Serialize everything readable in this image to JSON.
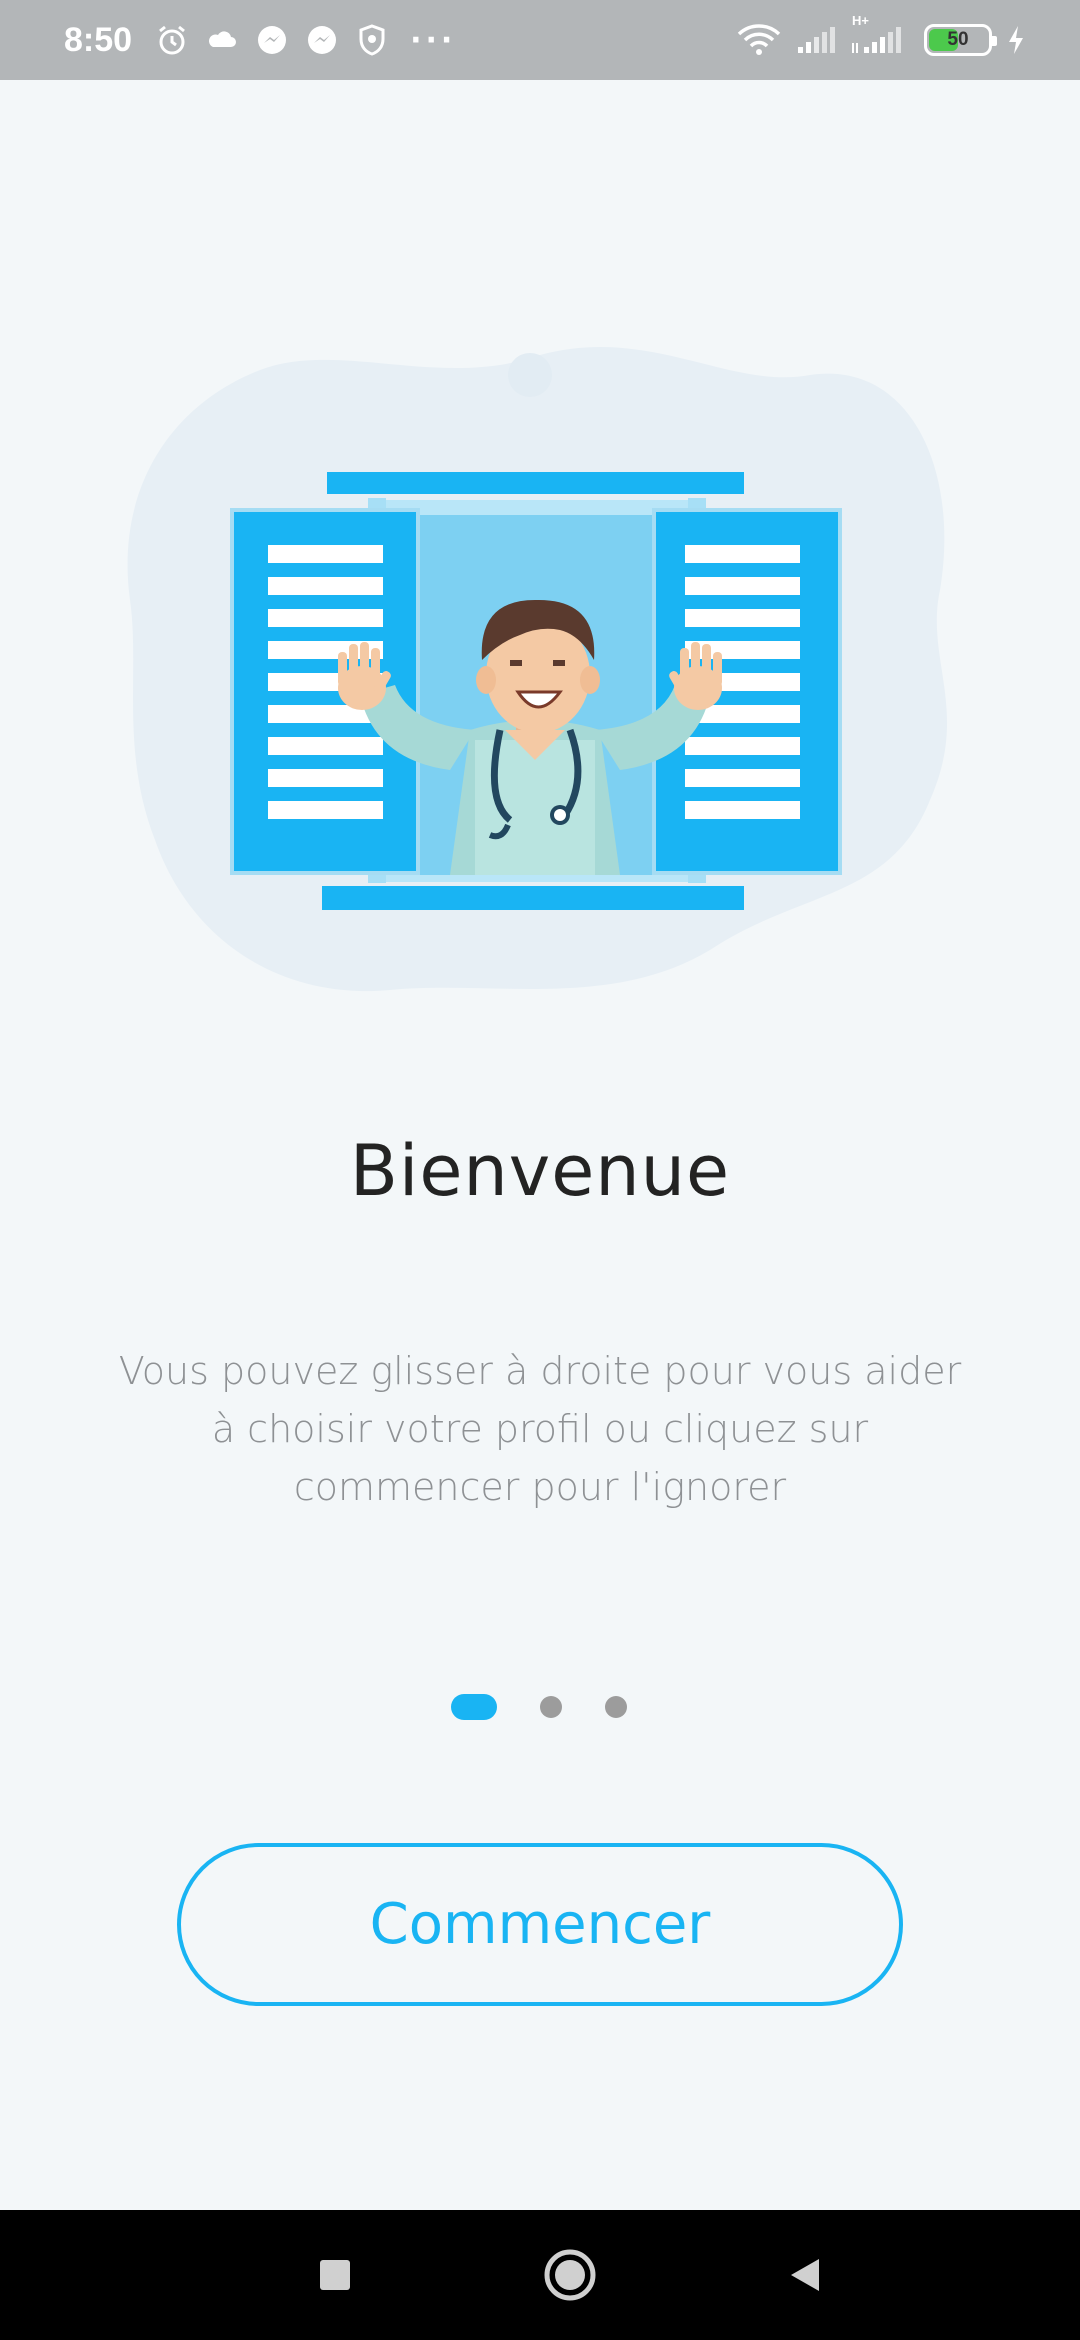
{
  "status_bar": {
    "time": "8:50",
    "battery_level": "50",
    "battery_percent": 50,
    "network_label": "H+",
    "icons": [
      "alarm-icon",
      "cloud-icon",
      "messenger-icon",
      "messenger-icon",
      "shield-icon",
      "more-dots-icon",
      "wifi-icon",
      "signal-icon",
      "signal-icon",
      "battery-icon",
      "charging-icon"
    ]
  },
  "onboarding": {
    "title": "Bienvenue",
    "description": "Vous pouvez glisser à droite pour vous aider à choisir votre profil ou cliquez sur commencer pour l'ignorer",
    "page_count": 3,
    "active_page": 1,
    "start_button_label": "Commencer"
  },
  "colors": {
    "accent": "#19b4f3",
    "background": "#f3f7f9",
    "status_bar": "#b3b6b8",
    "title": "#232323",
    "body_text": "#8e9194",
    "inactive_dot": "#9c9c9c"
  },
  "nav_bar": {
    "icons": [
      "recent-apps-icon",
      "home-icon",
      "back-icon"
    ]
  }
}
